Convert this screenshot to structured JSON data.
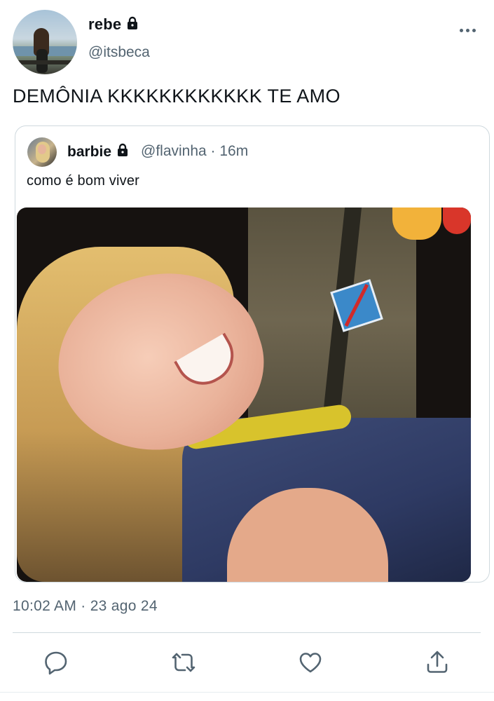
{
  "author": {
    "display_name": "rebe",
    "handle": "@itsbeca",
    "protected_icon": "lock-icon"
  },
  "tweet": {
    "text": "DEMÔNIA KKKKKKKKKKKK TE AMO",
    "timestamp": "10:02 AM · 23 ago 24"
  },
  "quoted": {
    "display_name": "barbie",
    "protected_icon": "lock-icon",
    "handle_time": "@flavinha · 16m",
    "text": "como é bom viver"
  },
  "actions": [
    {
      "name": "reply",
      "icon": "reply-icon"
    },
    {
      "name": "retweet",
      "icon": "retweet-icon"
    },
    {
      "name": "like",
      "icon": "heart-icon"
    },
    {
      "name": "share",
      "icon": "share-icon"
    }
  ],
  "colors": {
    "text_primary": "#0f1419",
    "text_secondary": "#536471",
    "border": "#cfd9de"
  }
}
